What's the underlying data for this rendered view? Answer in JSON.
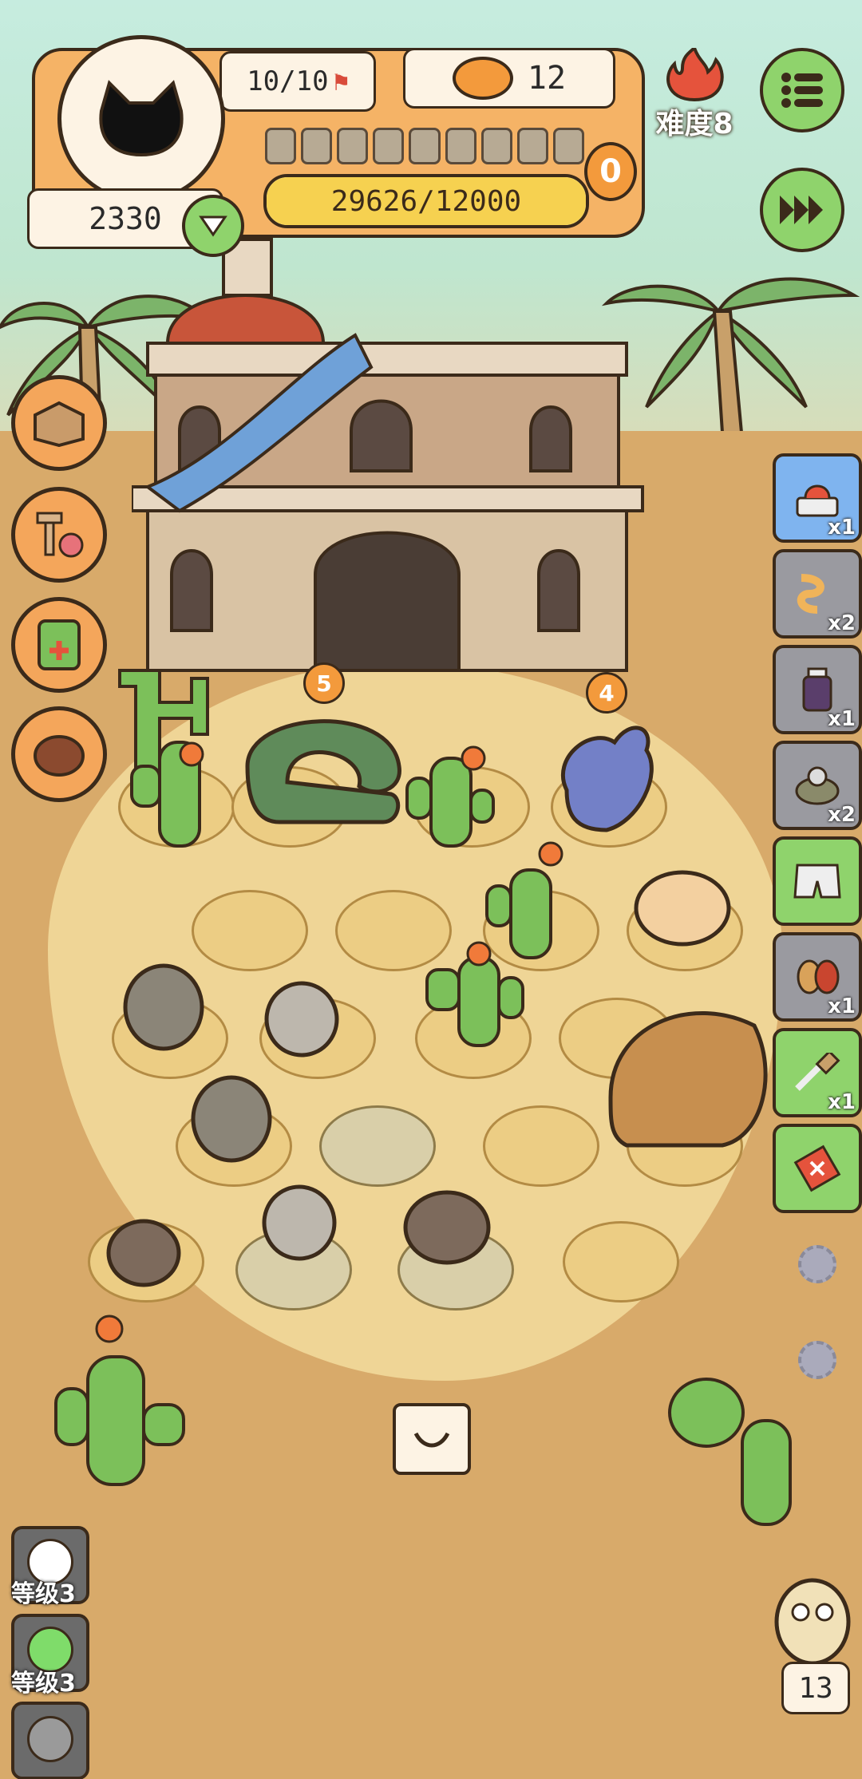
{
  "hud": {
    "capacity": "10/10",
    "cans": "12",
    "difficulty": "难度8",
    "coins": "2330",
    "progress_text": "29626/12000",
    "progress_fraction": 1.0,
    "counter": "0",
    "slots_total": 9
  },
  "markers": {
    "cage_left": "5",
    "cage_right": "4"
  },
  "inventory": [
    {
      "name": "scale",
      "count": "x1",
      "color": "blue"
    },
    {
      "name": "worms",
      "count": "x2",
      "color": "gray"
    },
    {
      "name": "medicine-bottle",
      "count": "x1",
      "color": "gray"
    },
    {
      "name": "cat-turtle",
      "count": "x2",
      "color": "gray"
    },
    {
      "name": "shorts",
      "count": "",
      "color": "green"
    },
    {
      "name": "peanuts",
      "count": "x1",
      "color": "gray"
    },
    {
      "name": "brush",
      "count": "x1",
      "color": "green"
    },
    {
      "name": "ticket",
      "count": "",
      "color": "green"
    }
  ],
  "levels": [
    {
      "label": "等级3",
      "color": "#ffffff"
    },
    {
      "label": "等级3",
      "color": "#7fdc6a"
    }
  ],
  "owl_counter": "13",
  "colors": {
    "accent_green": "#8fd36c",
    "hud_orange": "#f5b366",
    "progress_yellow": "#f6d150"
  }
}
